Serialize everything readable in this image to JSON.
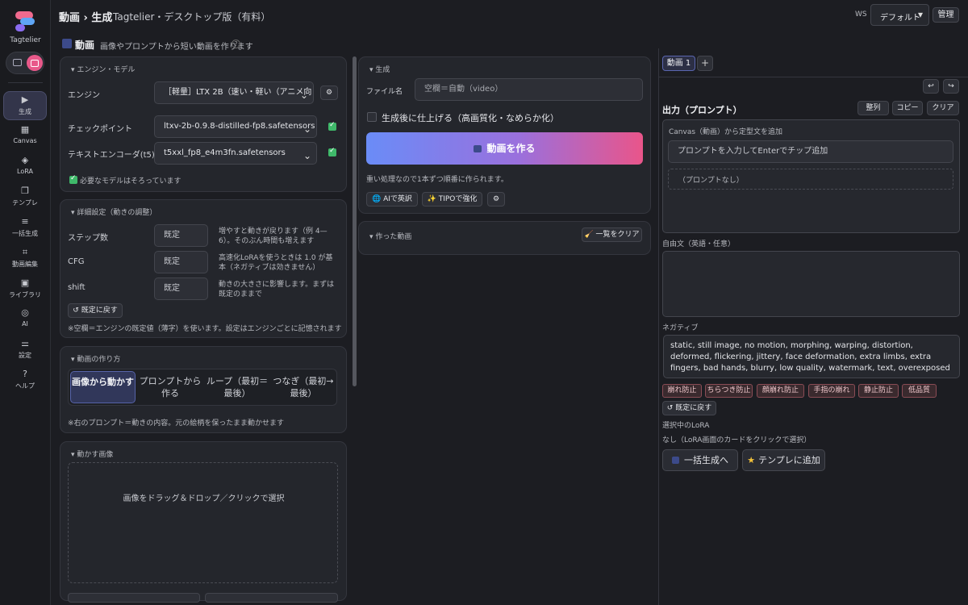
{
  "app": {
    "name": "Tagtelier"
  },
  "topbar": {
    "crumb": "動画 › 生成",
    "subtitle": "Tagtelier・デスクトップ版（有料）",
    "ws_label": "WS",
    "ws_value": "デフォルト",
    "admin": "管理"
  },
  "nav": [
    {
      "label": "生成",
      "icon": "▶"
    },
    {
      "label": "Canvas",
      "icon": "▦"
    },
    {
      "label": "LoRA",
      "icon": "◈"
    },
    {
      "label": "テンプレ",
      "icon": "❐"
    },
    {
      "label": "一括生成",
      "icon": "≡"
    },
    {
      "label": "動画編集",
      "icon": "⌗"
    },
    {
      "label": "ライブラリ",
      "icon": "▣"
    },
    {
      "label": "AI",
      "icon": "◎"
    },
    {
      "label": "設定",
      "icon": "⚌"
    },
    {
      "label": "ヘルプ",
      "icon": "?"
    }
  ],
  "header": {
    "title": "動画",
    "desc": "画像やプロンプトから短い動画を作ります",
    "help": "?"
  },
  "engine_panel": {
    "title": "エンジン・モデル",
    "engine_label": "エンジン",
    "engine_value": "［軽量］LTX 2B（速い・軽い（アニメ向",
    "checkpoint_label": "チェックポイント",
    "checkpoint_value": "ltxv-2b-0.9.8-distilled-fp8.safetensors",
    "encoder_label": "テキストエンコーダ(t5)",
    "encoder_value": "t5xxl_fp8_e4m3fn.safetensors",
    "models_ok": "必要なモデルはそろっています",
    "gear": "⚙"
  },
  "advanced_panel": {
    "title": "詳細設定（動きの調整）",
    "steps_label": "ステップ数",
    "steps_value": "既定",
    "steps_help": "増やすと動きが戻ります（例 4—6）。そのぶん時間も増えます",
    "cfg_label": "CFG",
    "cfg_value": "既定",
    "cfg_help": "高速化LoRAを使うときは 1.0 が基本（ネガティブは効きません）",
    "shift_label": "shift",
    "shift_value": "既定",
    "shift_help": "動きの大きさに影響します。まずは既定のままで",
    "reset": "↺ 既定に戻す",
    "note": "※空欄＝エンジンの既定値（薄字）を使います。設定はエンジンごとに記憶されます"
  },
  "mode_panel": {
    "title": "動画の作り方",
    "modes": [
      "画像から動かす",
      "プロンプトから作る",
      "ループ（最初＝最後）",
      "つなぎ（最初→最後）"
    ],
    "note": "※右のプロンプト＝動きの内容。元の絵柄を保ったまま動かせます"
  },
  "image_panel": {
    "title": "動かす画像",
    "drop": "画像をドラッグ＆ドロップ／クリックで選択"
  },
  "gen_panel": {
    "title": "生成",
    "filename_label": "ファイル名",
    "filename_placeholder": "空欄＝自動（video）",
    "finish_label": "生成後に仕上げる（高画質化・なめらか化）",
    "generate": "動画を作る",
    "note": "重い処理なので1本ずつ順番に作られます。",
    "ai_translate": "🌐 AIで英訳",
    "tipo": "✨ TIPOで強化",
    "gear": "⚙"
  },
  "made_panel": {
    "title": "作った動画",
    "clear": "一覧をクリア"
  },
  "right": {
    "tab": "動画 1",
    "tab_add": "+",
    "undo": "↩",
    "redo": "↪",
    "output_title": "出力（プロンプト）",
    "sort": "整列",
    "copy": "コピー",
    "clear": "クリア",
    "canvas_label": "Canvas（動画）から定型文を追加",
    "chip_input_placeholder": "プロンプトを入力してEnterでチップ追加",
    "no_prompt": "（プロンプトなし）",
    "free_label": "自由文（英語・任意）",
    "negative_label": "ネガティブ",
    "negative_text": "static, still image, no motion, morphing, warping, distortion, deformed, flickering, jittery, face deformation, extra limbs, extra fingers, bad hands, blurry, low quality, watermark, text, overexposed",
    "chips": [
      "崩れ防止",
      "ちらつき防止",
      "顔崩れ防止",
      "手指の崩れ",
      "静止防止",
      "低品質"
    ],
    "reset": "↺ 既定に戻す",
    "lora_label": "選択中のLoRA",
    "lora_value": "なし（LoRA画面のカードをクリックで選択）",
    "batch": "一括生成へ",
    "add_template": "テンプレに追加"
  }
}
